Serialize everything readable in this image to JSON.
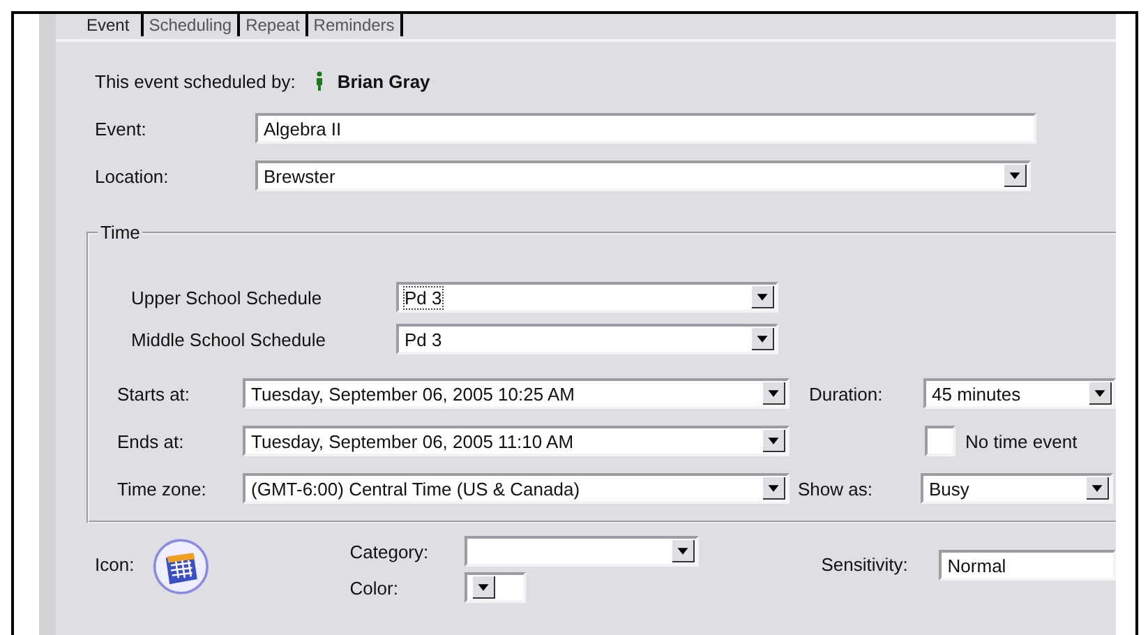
{
  "tabs": [
    {
      "label": "Event",
      "selected": true
    },
    {
      "label": "Scheduling",
      "selected": false
    },
    {
      "label": "Repeat",
      "selected": false
    },
    {
      "label": "Reminders",
      "selected": false
    }
  ],
  "scheduled_by": {
    "label": "This event scheduled by:",
    "name": "Brian Gray"
  },
  "event": {
    "label": "Event:",
    "value": "Algebra II"
  },
  "location": {
    "label": "Location:",
    "value": "Brewster"
  },
  "time": {
    "title": "Time",
    "schedules": [
      {
        "label": "Upper School Schedule",
        "value": "Pd 3",
        "focused": true
      },
      {
        "label": "Middle School Schedule",
        "value": "Pd 3",
        "focused": false
      }
    ],
    "starts": {
      "label": "Starts at:",
      "value": "Tuesday, September 06, 2005 10:25 AM"
    },
    "ends": {
      "label": "Ends at:",
      "value": "Tuesday, September 06, 2005 11:10 AM"
    },
    "time_zone": {
      "label": "Time zone:",
      "value": "(GMT-6:00) Central Time (US & Canada)"
    },
    "duration": {
      "label": "Duration:",
      "value": "45 minutes"
    },
    "no_time_event": {
      "label": "No time event",
      "checked": false
    },
    "show_as": {
      "label": "Show as:",
      "value": "Busy"
    }
  },
  "icon": {
    "label": "Icon:"
  },
  "category": {
    "label": "Category:"
  },
  "color": {
    "label": "Color:"
  },
  "sensitivity": {
    "label": "Sensitivity:",
    "value": "Normal"
  }
}
